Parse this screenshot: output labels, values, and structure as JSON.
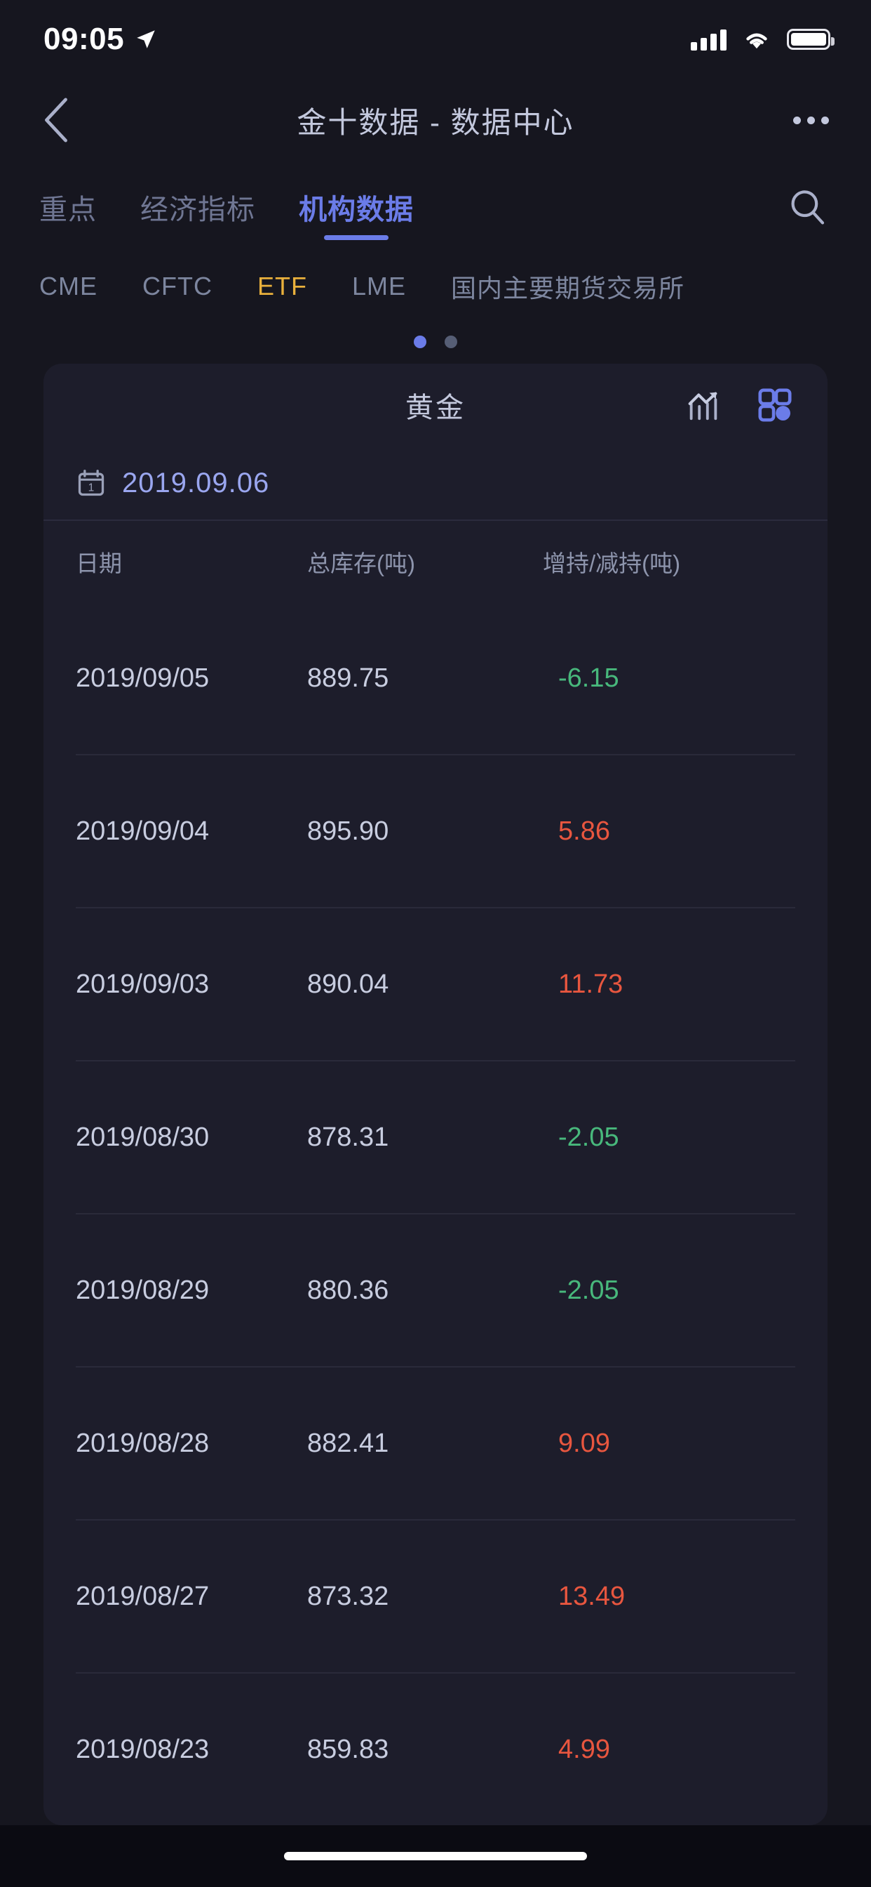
{
  "status_bar": {
    "time": "09:05",
    "location_icon": "location-arrow-icon",
    "signal_icon": "cellular-signal-icon",
    "wifi_icon": "wifi-icon",
    "battery_icon": "battery-full-icon"
  },
  "nav": {
    "back_icon": "chevron-left-icon",
    "title": "金十数据 - 数据中心",
    "more_icon": "more-horizontal-icon"
  },
  "tabs": {
    "items": [
      {
        "label": "重点",
        "active": false
      },
      {
        "label": "经济指标",
        "active": false
      },
      {
        "label": "机构数据",
        "active": true
      }
    ],
    "search_icon": "search-icon",
    "active_color": "#6b7ce8",
    "inactive_color": "#6f7693"
  },
  "subtabs": {
    "items": [
      {
        "label": "CME",
        "active": false
      },
      {
        "label": "CFTC",
        "active": false
      },
      {
        "label": "ETF",
        "active": true
      },
      {
        "label": "LME",
        "active": false
      },
      {
        "label": "国内主要期货交易所",
        "active": false
      }
    ],
    "active_color": "#e9b03c",
    "inactive_color": "#7d869f"
  },
  "pager": {
    "total": 2,
    "current": 1
  },
  "card": {
    "title": "黄金",
    "chart_view_icon": "chart-bar-trend-icon",
    "table_view_icon": "grid-view-icon",
    "chart_view_active": false,
    "table_view_active": true,
    "date_picker": {
      "icon": "calendar-icon",
      "value": "2019.09.06"
    },
    "columns": [
      "日期",
      "总库存(吨)",
      "增持/减持(吨)"
    ],
    "rows": [
      {
        "date": "2019/09/05",
        "stock": "889.75",
        "change": "-6.15",
        "dir": "down"
      },
      {
        "date": "2019/09/04",
        "stock": "895.90",
        "change": "5.86",
        "dir": "up"
      },
      {
        "date": "2019/09/03",
        "stock": "890.04",
        "change": "11.73",
        "dir": "up"
      },
      {
        "date": "2019/08/30",
        "stock": "878.31",
        "change": "-2.05",
        "dir": "down"
      },
      {
        "date": "2019/08/29",
        "stock": "880.36",
        "change": "-2.05",
        "dir": "down"
      },
      {
        "date": "2019/08/28",
        "stock": "882.41",
        "change": "9.09",
        "dir": "up"
      },
      {
        "date": "2019/08/27",
        "stock": "873.32",
        "change": "13.49",
        "dir": "up"
      },
      {
        "date": "2019/08/23",
        "stock": "859.83",
        "change": "4.99",
        "dir": "up"
      }
    ],
    "up_color": "#e8563f",
    "down_color": "#48b87c"
  },
  "home_indicator": "home-indicator-bar"
}
